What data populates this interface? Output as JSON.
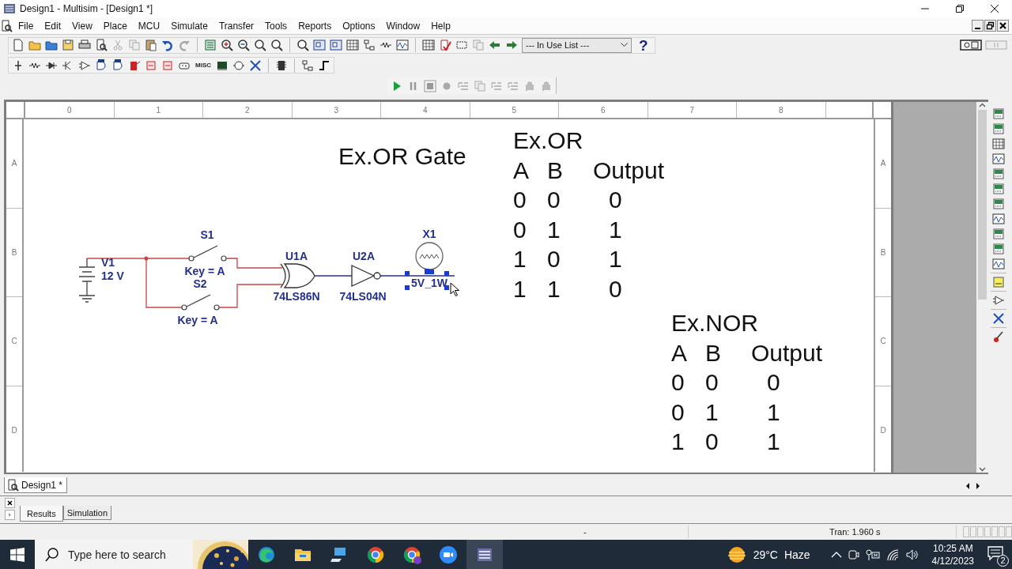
{
  "window": {
    "title": "Design1 - Multisim - [Design1 *]"
  },
  "menu": [
    "File",
    "Edit",
    "View",
    "Place",
    "MCU",
    "Simulate",
    "Transfer",
    "Tools",
    "Reports",
    "Options",
    "Window",
    "Help"
  ],
  "toolbar": {
    "in_use_list": {
      "value": "--- In Use List ---"
    },
    "help": "?"
  },
  "component_toolbar": {
    "misc": "MISC"
  },
  "sheet": {
    "column_labels": [
      "0",
      "1",
      "2",
      "3",
      "4",
      "5",
      "6",
      "7",
      "8"
    ],
    "row_labels_left": [
      "A",
      "B",
      "C",
      "D"
    ],
    "row_labels_right": [
      "A",
      "B",
      "C",
      "D"
    ],
    "title": "Ex.OR Gate",
    "components": [
      {
        "kind": "battery",
        "ref": "V1",
        "value": "12 V",
        "selected": false
      },
      {
        "kind": "switch",
        "ref": "S1",
        "value": "Key = A",
        "selected": false
      },
      {
        "kind": "switch",
        "ref": "S2",
        "value": "Key = A",
        "selected": false
      },
      {
        "kind": "xor_gate",
        "ref": "U1A",
        "value": "74LS86N",
        "selected": false
      },
      {
        "kind": "not_gate",
        "ref": "U2A",
        "value": "74LS04N",
        "selected": false
      },
      {
        "kind": "lamp",
        "ref": "X1",
        "value": "5V_1W",
        "selected": true
      }
    ],
    "truth_tables": [
      {
        "title": "Ex.OR",
        "header": [
          "A",
          "B",
          "Output"
        ],
        "rows": [
          [
            "0",
            "0",
            "0"
          ],
          [
            "0",
            "1",
            "1"
          ],
          [
            "1",
            "0",
            "1"
          ],
          [
            "1",
            "1",
            "0"
          ]
        ]
      },
      {
        "title": "Ex.NOR",
        "header": [
          "A",
          "B",
          "Output"
        ],
        "rows": [
          [
            "0",
            "0",
            "0"
          ],
          [
            "0",
            "1",
            "1"
          ],
          [
            "1",
            "0",
            "1"
          ]
        ]
      }
    ]
  },
  "document_tabs": [
    {
      "label": "Design1 *",
      "selected": true
    }
  ],
  "output_tabs": [
    {
      "label": "Results",
      "selected": true
    },
    {
      "label": "Simulation",
      "selected": false
    }
  ],
  "status_bar": {
    "field_1": "-",
    "analysis": "Tran: 1.960 s"
  },
  "taskbar": {
    "search": {
      "placeholder": "Type here to search"
    },
    "weather": {
      "temperature": "29°C",
      "condition": "Haze"
    },
    "time": "10:25 AM",
    "date": "4/12/2023",
    "notifications": "2"
  }
}
